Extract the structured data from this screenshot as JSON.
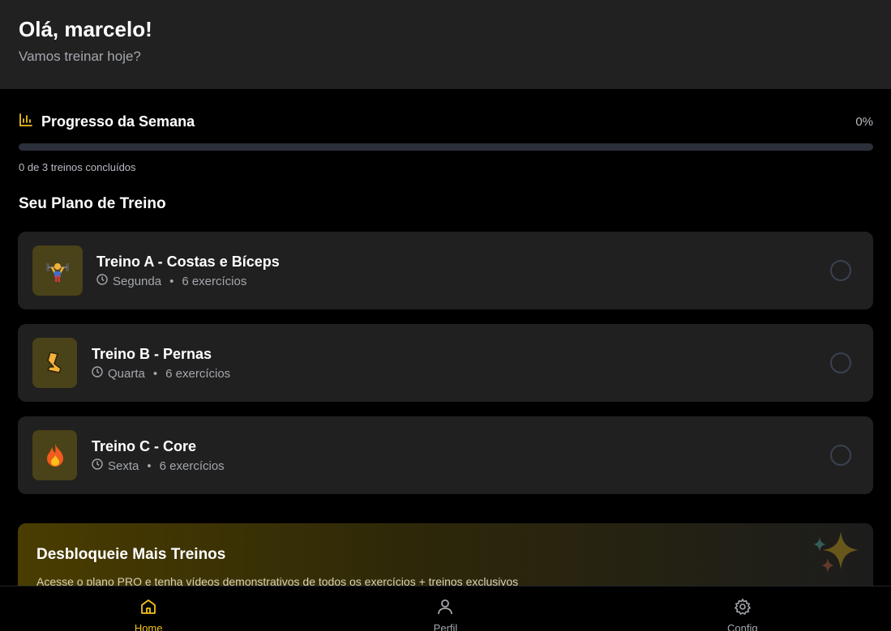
{
  "header": {
    "greeting": "Olá, marcelo!",
    "subtitle": "Vamos treinar hoje?"
  },
  "progress": {
    "title": "Progresso da Semana",
    "percent_label": "0%",
    "value": 0,
    "caption": "0 de 3 treinos concluídos",
    "icon": "bar-chart-icon"
  },
  "plan": {
    "title": "Seu Plano de Treino",
    "workouts": [
      {
        "title": "Treino A - Costas e Bíceps",
        "day": "Segunda",
        "exercises": "6 exercícios",
        "icon": "weightlifter-emoji",
        "done": false
      },
      {
        "title": "Treino B - Pernas",
        "day": "Quarta",
        "exercises": "6 exercícios",
        "icon": "leg-emoji",
        "done": false
      },
      {
        "title": "Treino C - Core",
        "day": "Sexta",
        "exercises": "6 exercícios",
        "icon": "fire-emoji",
        "done": false
      }
    ],
    "separator": "•"
  },
  "promo": {
    "title": "Desbloqueie Mais Treinos",
    "text": "Acesse o plano PRO e tenha vídeos demonstrativos de todos os exercícios + treinos exclusivos",
    "icon": "sparkles-icon"
  },
  "nav": {
    "items": [
      {
        "label": "Home",
        "icon": "home-icon",
        "active": true
      },
      {
        "label": "Perfil",
        "icon": "user-icon",
        "active": false
      },
      {
        "label": "Config",
        "icon": "gear-icon",
        "active": false
      }
    ]
  },
  "colors": {
    "accent": "#f2c21b",
    "background": "#000000",
    "card": "#202020",
    "header": "#212121"
  }
}
